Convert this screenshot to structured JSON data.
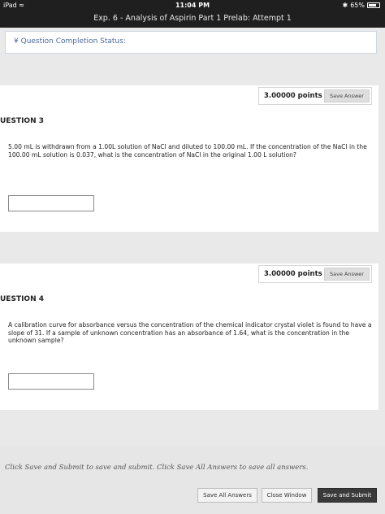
{
  "status_bar": {
    "device": "iPad",
    "time": "11:04 PM",
    "battery": "65%",
    "battery_level": 0.65
  },
  "window": {
    "title": "Exp. 6 - Analysis of Aspirin Part 1 Prelab: Attempt 1"
  },
  "completion": {
    "label": "Question Completion Status:"
  },
  "questions": [
    {
      "points": "3.00000 points",
      "save_label": "Save Answer",
      "heading": "UESTION 3",
      "text": "5.00 mL is withdrawn from a 1.00L solution of NaCl and diluted to 100.00 mL.  If the concentration of the NaCl in the 100.00 mL solution is 0.037, what is the concentration of NaCl in the original 1.00 L solution?",
      "answer": ""
    },
    {
      "points": "3.00000 points",
      "save_label": "Save Answer",
      "heading": "UESTION 4",
      "text": "A calibration curve for absorbance versus the concentration of the chemical indicator crystal violet  is found to have a slope of 31.  If a sample of unknown concentration has an absorbance of 1.64, what is the concentration in the unknown sample?",
      "answer": ""
    }
  ],
  "footer": {
    "hint": "Click Save and Submit to save and submit. Click Save All Answers to save all answers.",
    "save_all": "Save All Answers",
    "close_window": "Close Window",
    "save_submit": "Save and Submit"
  }
}
